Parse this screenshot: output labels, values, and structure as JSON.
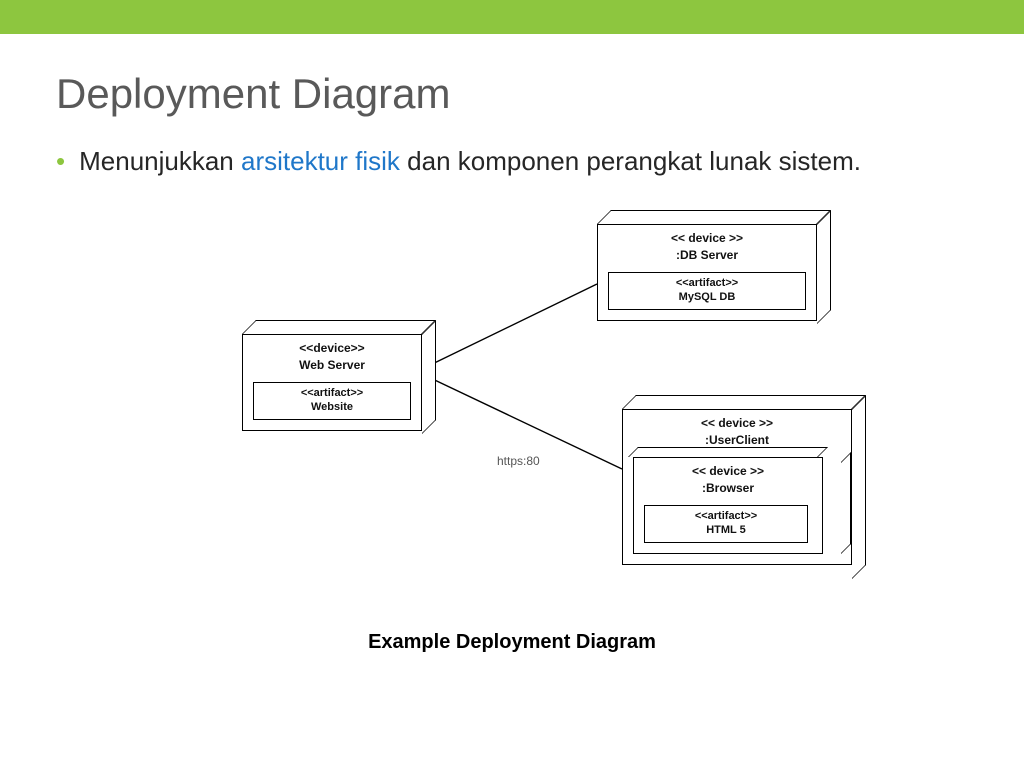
{
  "slide": {
    "title": "Deployment Diagram",
    "bullet_prefix": "Menunjukkan ",
    "bullet_highlight": "arsitektur fisik",
    "bullet_suffix": " dan komponen perangkat lunak sistem."
  },
  "diagram": {
    "caption": "Example Deployment Diagram",
    "edge_label": "https:80",
    "nodes": {
      "webserver": {
        "stereotype": "<<device>>",
        "name": "Web Server",
        "artifact_stereotype": "<<artifact>>",
        "artifact_name": "Website"
      },
      "dbserver": {
        "stereotype": "<< device >>",
        "name": ":DB Server",
        "artifact_stereotype": "<<artifact>>",
        "artifact_name": "MySQL DB"
      },
      "userclient": {
        "stereotype": "<< device >>",
        "name": ":UserClient",
        "browser": {
          "stereotype": "<< device >>",
          "name": ":Browser",
          "artifact_stereotype": "<<artifact>>",
          "artifact_name": "HTML 5"
        }
      }
    }
  }
}
